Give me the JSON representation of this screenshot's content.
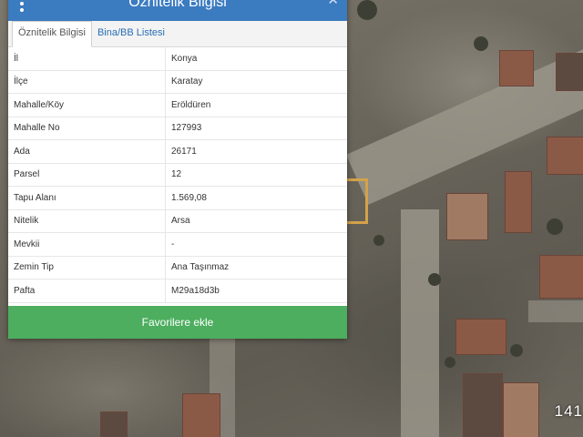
{
  "panel": {
    "title": "Öznitelik Bilgisi",
    "close_symbol": "✕",
    "menu_icon": "more-vertical-icon",
    "tabs": [
      {
        "label": "Öznitelik Bilgisi",
        "active": true
      },
      {
        "label": "Bina/BB Listesi",
        "active": false
      }
    ],
    "rows": [
      {
        "key": "İl",
        "value": "Konya"
      },
      {
        "key": "İlçe",
        "value": "Karatay"
      },
      {
        "key": "Mahalle/Köy",
        "value": "Eröldüren"
      },
      {
        "key": "Mahalle No",
        "value": "127993"
      },
      {
        "key": "Ada",
        "value": "26171"
      },
      {
        "key": "Parsel",
        "value": "12"
      },
      {
        "key": "Tapu Alanı",
        "value": "1.569,08"
      },
      {
        "key": "Nitelik",
        "value": "Arsa"
      },
      {
        "key": "Mevkii",
        "value": "-"
      },
      {
        "key": "Zemin Tip",
        "value": "Ana Taşınmaz"
      },
      {
        "key": "Pafta",
        "value": "M29a18d3b"
      }
    ],
    "favorite_button": "Favorilere ekle"
  },
  "map": {
    "corner_label": "141"
  },
  "colors": {
    "header": "#3b7bc0",
    "favorite_button": "#4cae5e",
    "parcel_outline": "#d3a24a"
  }
}
